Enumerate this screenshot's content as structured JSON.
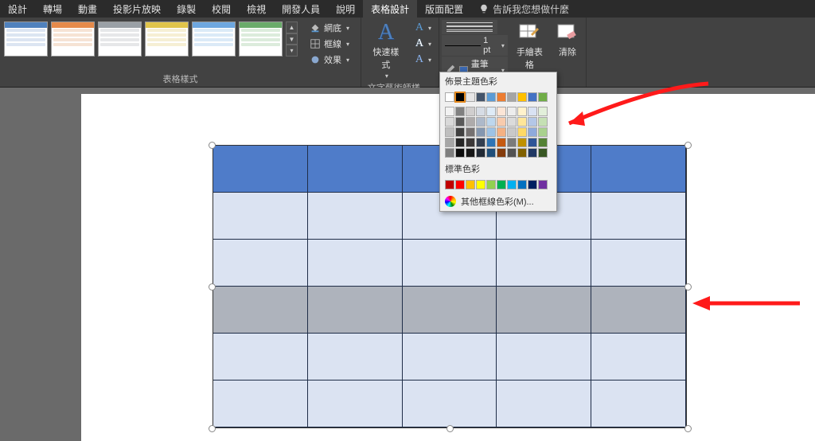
{
  "tabs": {
    "items": [
      "設計",
      "轉場",
      "動畫",
      "投影片放映",
      "錄製",
      "校閱",
      "檢視",
      "開發人員",
      "說明",
      "表格設計",
      "版面配置"
    ],
    "active_index": 9,
    "tell_me": "告訴我您想做什麼"
  },
  "ribbon": {
    "styles_label": "表格樣式",
    "style_colors": [
      "#4f81bd",
      "#e58a4a",
      "#9aa0a6",
      "#e0c44a",
      "#6da7e0",
      "#6aab6a"
    ],
    "shading": "網底",
    "borders": "框線",
    "effects": "效果",
    "wordart": {
      "big": "快速樣式",
      "group_label": "文字藝術師樣式"
    },
    "pen": {
      "weight": "1 pt",
      "color_label": "畫筆色彩",
      "draw_table": "手繪表格",
      "eraser": "清除"
    }
  },
  "popup": {
    "theme_title": "佈景主題色彩",
    "theme_row1": [
      "#ffffff",
      "#000000",
      "#e7e6e6",
      "#44546a",
      "#5b9bd5",
      "#ed7d31",
      "#a5a5a5",
      "#ffc000",
      "#4472c4",
      "#70ad47"
    ],
    "theme_shades": [
      [
        "#f2f2f2",
        "#808080",
        "#d0cece",
        "#d6dce5",
        "#deebf7",
        "#fbe5d6",
        "#ededed",
        "#fff2cc",
        "#d9e2f3",
        "#e2efda"
      ],
      [
        "#d9d9d9",
        "#595959",
        "#aeabab",
        "#adb9ca",
        "#bdd7ee",
        "#f8cbad",
        "#dbdbdb",
        "#ffe699",
        "#b4c7e7",
        "#c5e0b4"
      ],
      [
        "#bfbfbf",
        "#404040",
        "#757171",
        "#8497b0",
        "#9dc3e6",
        "#f4b183",
        "#c9c9c9",
        "#ffd966",
        "#8faadc",
        "#a9d18e"
      ],
      [
        "#a6a6a6",
        "#262626",
        "#3b3838",
        "#333f50",
        "#2e75b6",
        "#c55a11",
        "#7b7b7b",
        "#bf9000",
        "#2f5597",
        "#548235"
      ],
      [
        "#7f7f7f",
        "#0d0d0d",
        "#171717",
        "#222a35",
        "#1f4e79",
        "#843c0c",
        "#525252",
        "#806000",
        "#203864",
        "#385723"
      ]
    ],
    "standard_title": "標準色彩",
    "standard": [
      "#c00000",
      "#ff0000",
      "#ffc000",
      "#ffff00",
      "#92d050",
      "#00b050",
      "#00b0f0",
      "#0070c0",
      "#002060",
      "#7030a0"
    ],
    "more": "其他框線色彩(M)..."
  }
}
